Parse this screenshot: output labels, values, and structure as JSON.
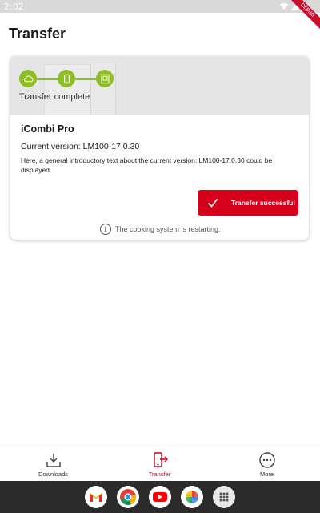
{
  "status_bar": {
    "time": "2:02",
    "debug_label": "DEBUG"
  },
  "page": {
    "title": "Transfer"
  },
  "card": {
    "progress_status": "Transfer complete",
    "steps": [
      "cloud-icon",
      "mobile-device-icon",
      "cooking-system-icon"
    ],
    "product_name": "iCombi Pro",
    "current_version": "Current version: LM100-17.0.30",
    "description": "Here, a general introductory text about the current version: LM100-17.0.30 could be displayed.",
    "success_button": {
      "label": "Transfer successful",
      "icon": "check-icon"
    },
    "restart_note": "The cooking system is restarting."
  },
  "bottom_nav": {
    "items": [
      {
        "label": "Downloads",
        "icon": "download-tray-icon",
        "active": false
      },
      {
        "label": "Transfer",
        "icon": "transfer-device-icon",
        "active": true
      },
      {
        "label": "More",
        "icon": "more-circle-icon",
        "active": false
      }
    ]
  },
  "dock": {
    "apps": [
      "gmail-icon",
      "chrome-icon",
      "youtube-icon",
      "photos-icon",
      "app-drawer-icon"
    ]
  },
  "colors": {
    "accent_red": "#d6001c",
    "progress_green": "#8dbe22",
    "header_gray": "#e5e5e5"
  }
}
